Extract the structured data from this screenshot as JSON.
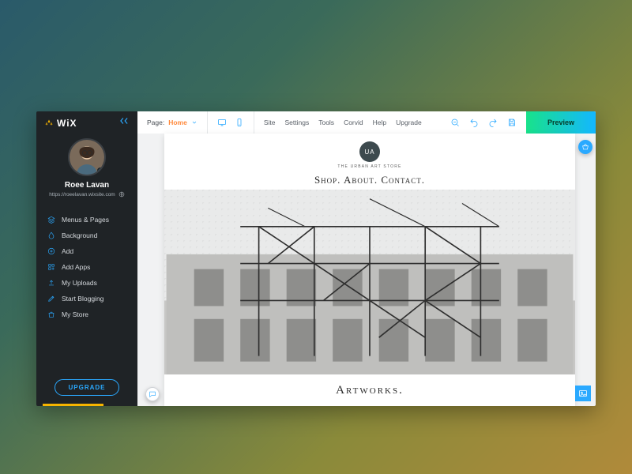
{
  "brand": {
    "name": "WiX"
  },
  "user": {
    "name": "Roee Lavan",
    "url": "https://roeelavan.wixsite.com"
  },
  "sidebar": {
    "items": [
      {
        "icon": "menus",
        "label": "Menus & Pages"
      },
      {
        "icon": "bg",
        "label": "Background"
      },
      {
        "icon": "add",
        "label": "Add"
      },
      {
        "icon": "apps",
        "label": "Add Apps"
      },
      {
        "icon": "uploads",
        "label": "My Uploads"
      },
      {
        "icon": "blog",
        "label": "Start Blogging"
      },
      {
        "icon": "store",
        "label": "My Store"
      }
    ],
    "upgrade": "UPGRADE"
  },
  "topbar": {
    "page_label": "Page:",
    "page_value": "Home",
    "menu": [
      "Site",
      "Settings",
      "Tools",
      "Corvid",
      "Help",
      "Upgrade"
    ],
    "preview": "Preview"
  },
  "site": {
    "logo_initials": "UA",
    "tagline": "The urban art store",
    "nav": "Shop.   About.   Contact.",
    "section": "Artworks."
  }
}
